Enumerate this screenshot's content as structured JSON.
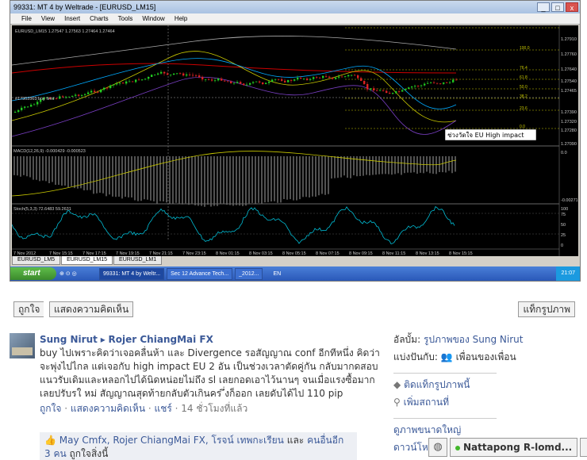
{
  "window": {
    "title": "99331: MT 4 by Weltrade - [EURUSD_LM15]",
    "menu": [
      "File",
      "View",
      "Insert",
      "Charts",
      "Tools",
      "Window",
      "Help"
    ]
  },
  "chart": {
    "info_label": "EURUSD_LM15  1.27547 1.27563 1.27464 1.27464",
    "order_label": "#17303563 buy limit",
    "macd_label": "MACD(12,26,9) -0.000429 -0.000523",
    "stoch_label": "Stoch(5,3,3) 72.6483 59.2631",
    "annotation": "ช่วงวัดใจ EU High impact",
    "price_labels": [
      "1.27910",
      "1.27760",
      "1.27640",
      "1.27540",
      "1.27465",
      "1.27390",
      "1.27320",
      "1.27280",
      "1.27090"
    ],
    "fib_labels": [
      "100.0",
      "76.4",
      "61.8",
      "50.0",
      "38.2",
      "23.6",
      "0.0"
    ],
    "macd_scale": [
      "0.0",
      "-0.00271"
    ],
    "stoch_scale": [
      "100",
      "75",
      "50",
      "25",
      "0"
    ],
    "time_labels": [
      "7 Nov 2012",
      "7 Nov 15:15",
      "7 Nov 17:15",
      "7 Nov 19:15",
      "7 Nov 21:15",
      "7 Nov 23:15",
      "8 Nov 01:15",
      "8 Nov 03:15",
      "8 Nov 05:15",
      "8 Nov 07:15",
      "8 Nov 09:15",
      "8 Nov 11:15",
      "8 Nov 13:15",
      "8 Nov 15:15"
    ]
  },
  "chart_tabs": [
    "EURUSD_LM5",
    "EURUSD_LM15",
    "EURUSD_LM1"
  ],
  "taskbar": {
    "start": "start",
    "items": [
      "99331: MT 4 by Weltr...",
      "Sec 12 Advance Tech...",
      "_2012..."
    ],
    "lang": "EN",
    "clock": "21:07"
  },
  "actions": {
    "like": "ถูกใจ",
    "comment": "แสดงความคิดเห็น",
    "tag": "แท็กรูปภาพ"
  },
  "post": {
    "author": "Sung Nirut",
    "target": "Rojer ChiangMai FX",
    "body": "buy ไปเพราะคิดว่าเจอคลื่นห้า และ Divergence รอสัญญาณ conf อีกทีหนึ่ง คิดว่าจะพุ่งไปไกล แต่เจอกับ high impact EU 2 อัน เป็นช่วงเวลาตัดคู่กัน กลับมากดสอบแนวรับเดิมและหลอกไปได้นิดหน่อยไม่ถึง sl เลยกอดเอาไว้นานๆ จนเมื่อแรงซื้อมาก เลยปรับรใ หม่ สัญญาณสุดท้ายกลับตัวเกินคร ึ่งก็ออก เลยดับได้ไป 110 pip",
    "meta_like": "ถูกใจ",
    "meta_comment": "แสดงความคิดเห็น",
    "meta_share": "แชร์",
    "meta_time": "14 ชั่วโมงที่แล้ว",
    "likes_names": "May Cmfx, Rojer ChiangMai FX, โรจน์ เทพกะเรียน",
    "likes_and": "และ",
    "likes_others": "คนอื่นอีก 3 คน",
    "likes_suffix": "ถูกใจสิ่งนี้"
  },
  "sidebar": {
    "album_label": "อัลบั้ม:",
    "album_value": "รูปภาพของ Sung Nirut",
    "share_label": "แบ่งปันกับ:",
    "share_value": "เพื่อนของเพื่อน",
    "tag_link": "ติดแท็กรูปภาพนี้",
    "place_link": "เพิ่มสถานที่",
    "large_link": "ดูภาพขนาดใหญ่",
    "download_link": "ดาวน์โห"
  },
  "chat": {
    "name": "Nattapong R-lomd..."
  }
}
